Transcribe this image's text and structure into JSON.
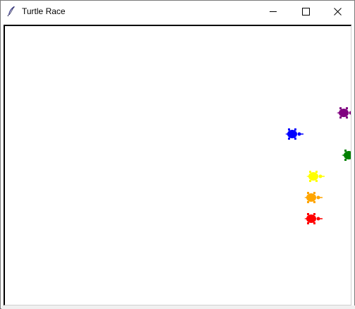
{
  "window": {
    "title": "Turtle Race",
    "icon": "feather-icon",
    "controls": [
      "minimize-icon",
      "maximize-icon",
      "close-icon"
    ]
  },
  "race": {
    "turtles": [
      {
        "color": "#800080",
        "name": "purple"
      },
      {
        "color": "#0000ff",
        "name": "blue"
      },
      {
        "color": "#008000",
        "name": "green"
      },
      {
        "color": "#ffff00",
        "name": "yellow"
      },
      {
        "color": "#ffa500",
        "name": "orange"
      },
      {
        "color": "#ff0000",
        "name": "red"
      }
    ]
  }
}
